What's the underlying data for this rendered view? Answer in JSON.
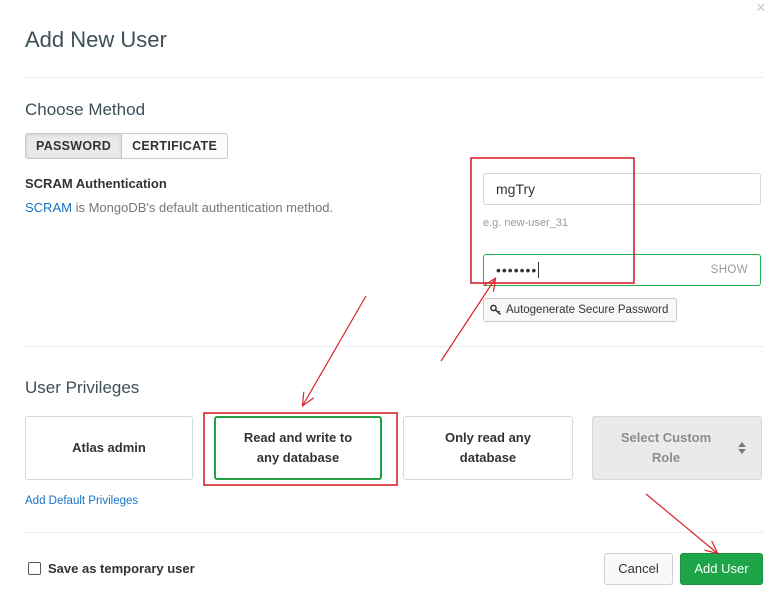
{
  "dialog": {
    "title": "Add New User",
    "close_glyph": "×"
  },
  "method": {
    "heading": "Choose Method",
    "options": [
      "PASSWORD",
      "CERTIFICATE"
    ],
    "selected": "PASSWORD"
  },
  "scram": {
    "title": "SCRAM Authentication",
    "link_text": "SCRAM",
    "description": " is MongoDB's default authentication method."
  },
  "credentials": {
    "username_value": "mgTry",
    "username_hint": "e.g. new-user_31",
    "password_mask": "•••••••",
    "show_label": "SHOW",
    "autogen_label": "Autogenerate Secure Password"
  },
  "privileges": {
    "heading": "User Privileges",
    "roles": [
      {
        "line1": "Atlas admin",
        "line2": ""
      },
      {
        "line1": "Read and write to",
        "line2": "any database"
      },
      {
        "line1": "Only read any",
        "line2": "database"
      },
      {
        "line1": "Select Custom",
        "line2": "Role"
      }
    ],
    "selected_role_index": 1,
    "add_default_link": "Add Default Privileges"
  },
  "footer": {
    "temporary_label": "Save as temporary user",
    "temporary_checked": false,
    "cancel_label": "Cancel",
    "add_user_label": "Add User"
  },
  "colors": {
    "accent_green": "#1ea449",
    "link_blue": "#1a73c7",
    "annotation_red": "#d9232d"
  },
  "icons": {
    "close": "close-icon",
    "key": "key-icon",
    "sort": "sort-icon",
    "checkbox": "checkbox-icon"
  }
}
